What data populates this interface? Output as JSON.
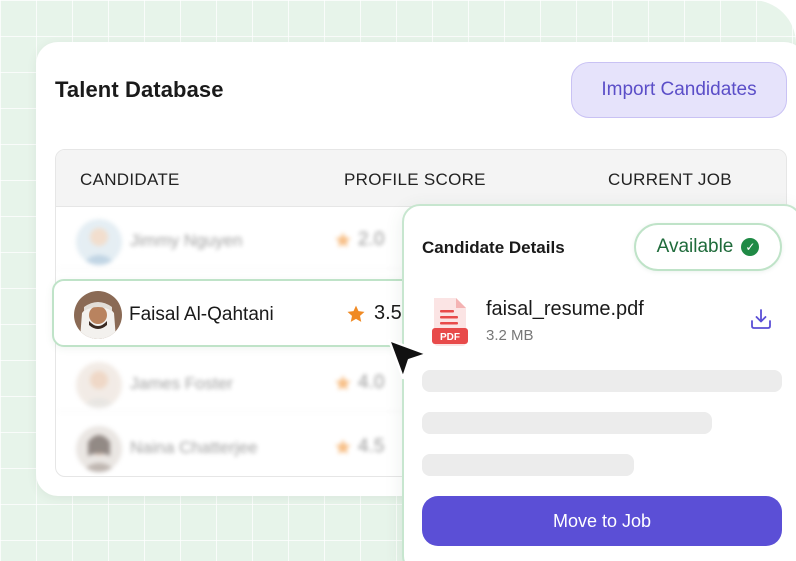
{
  "page": {
    "title": "Talent Database"
  },
  "header": {
    "import_label": "Import Candidates"
  },
  "table": {
    "columns": [
      "CANDIDATE",
      "PROFILE SCORE",
      "CURRENT JOB"
    ],
    "rows": [
      {
        "name": "Jimmy Nguyen",
        "score": "2.0",
        "highlighted": false
      },
      {
        "name": "Faisal Al-Qahtani",
        "score": "3.5",
        "highlighted": true
      },
      {
        "name": "James Foster",
        "score": "4.0",
        "highlighted": false
      },
      {
        "name": "Naina Chatterjee",
        "score": "4.5",
        "highlighted": false
      }
    ]
  },
  "details": {
    "title": "Candidate Details",
    "status": "Available",
    "file": {
      "name": "faisal_resume.pdf",
      "size": "3.2 MB",
      "badge": "PDF"
    },
    "move_label": "Move to Job"
  },
  "colors": {
    "accent": "#5b4fd6",
    "success": "#1f8a45",
    "star": "#f08a24",
    "pdf_red": "#e84a4a"
  },
  "icons": [
    "star-icon",
    "check-circle-icon",
    "pdf-file-icon",
    "download-icon",
    "mouse-cursor-icon"
  ]
}
